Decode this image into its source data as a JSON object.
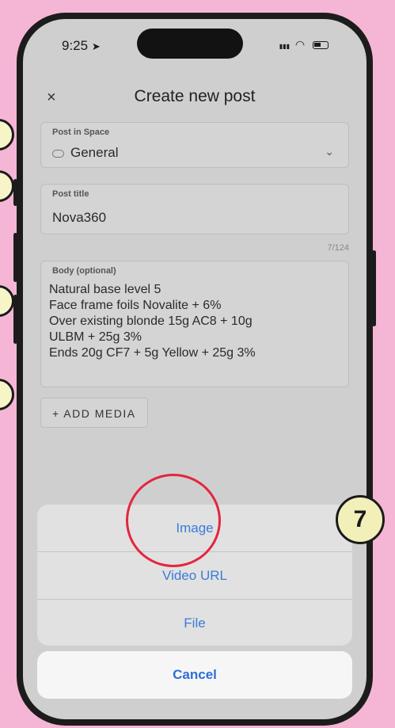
{
  "status_bar": {
    "time": "9:25",
    "signal": "▮▮▮",
    "wifi": "◠"
  },
  "header": {
    "close": "×",
    "title": "Create new post"
  },
  "space_field": {
    "label": "Post in Space",
    "value": "General",
    "chevron": "⌄"
  },
  "title_field": {
    "label": "Post title",
    "value": "Nova360",
    "counter": "7/124"
  },
  "body_field": {
    "label": "Body (optional)",
    "lines": [
      "Natural base level 5",
      "Face frame foils Novalite + 6%",
      "Over existing blonde 15g AC8 + 10g",
      "ULBM + 25g 3%",
      "Ends 20g CF7 + 5g Yellow + 25g 3%"
    ]
  },
  "add_media": "+ ADD MEDIA",
  "action_sheet": {
    "items": [
      "Image",
      "Video URL",
      "File"
    ],
    "cancel": "Cancel"
  },
  "step_badge": "7",
  "colors": {
    "background": "#f5b6d6",
    "highlight": "#e3263f",
    "badge": "#f2f0b8",
    "link": "#3b7bd9"
  }
}
